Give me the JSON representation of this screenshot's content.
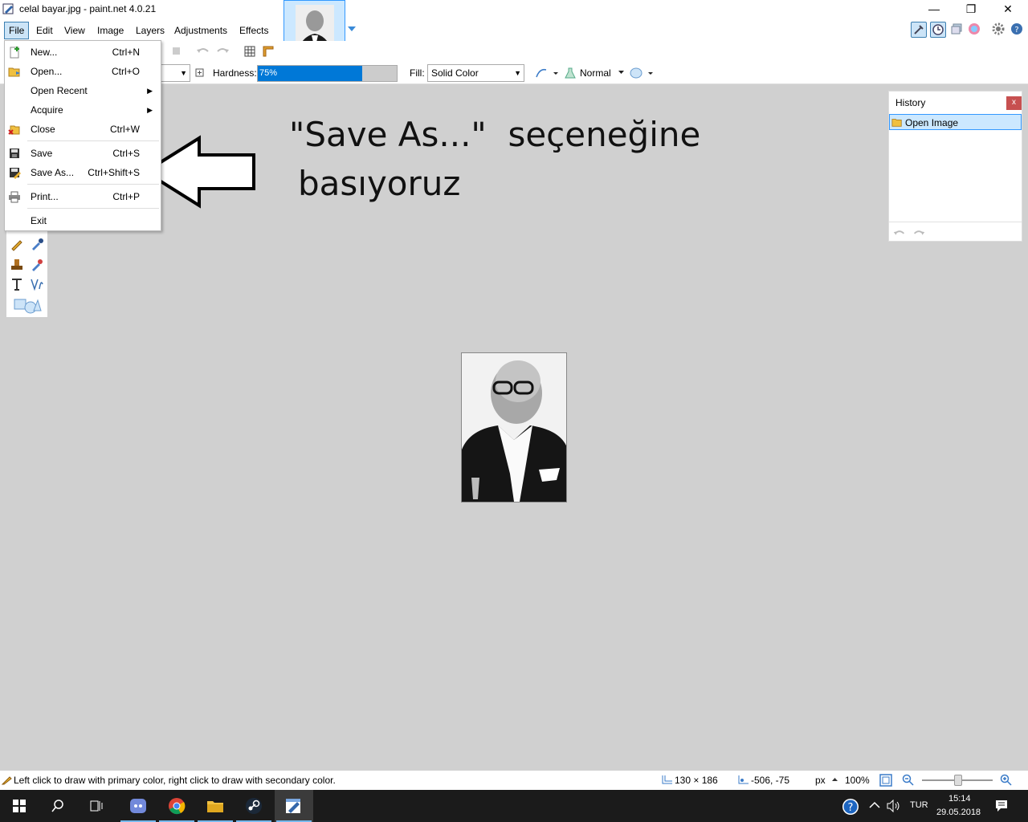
{
  "window": {
    "title": "celal bayar.jpg - paint.net 4.0.21",
    "minimize_glyph": "—",
    "maximize_glyph": "❐",
    "close_glyph": "✕"
  },
  "menubar": {
    "items": [
      "File",
      "Edit",
      "View",
      "Image",
      "Layers",
      "Adjustments",
      "Effects"
    ]
  },
  "toolbar": {
    "hardness_label": "Hardness:",
    "hardness_value": "75%",
    "hardness_fraction": 0.75,
    "fill_label": "Fill:",
    "fill_value": "Solid Color",
    "blend_mode": "Normal"
  },
  "file_menu": {
    "items": [
      {
        "label": "New...",
        "shortcut": "Ctrl+N",
        "icon": "new-image-icon"
      },
      {
        "label": "Open...",
        "shortcut": "Ctrl+O",
        "icon": "open-folder-icon"
      },
      {
        "label": "Open Recent",
        "shortcut": "",
        "icon": "",
        "submenu": true
      },
      {
        "label": "Acquire",
        "shortcut": "",
        "icon": "",
        "submenu": true
      },
      {
        "label": "Close",
        "shortcut": "Ctrl+W",
        "icon": "close-file-icon"
      },
      {
        "label": "Save",
        "shortcut": "Ctrl+S",
        "icon": "save-disk-icon"
      },
      {
        "label": "Save As...",
        "shortcut": "Ctrl+Shift+S",
        "icon": "save-as-icon"
      },
      {
        "label": "Print...",
        "shortcut": "Ctrl+P",
        "icon": "printer-icon"
      },
      {
        "label": "Exit",
        "shortcut": "",
        "icon": ""
      }
    ]
  },
  "annotation": {
    "line1": "\"Save As...\"  seçeneğine",
    "line2": "basıyoruz"
  },
  "history": {
    "title": "History",
    "close": "x",
    "items": [
      "Open Image"
    ]
  },
  "statusbar": {
    "hint": "Left click to draw with primary color, right click to draw with secondary color.",
    "image_size": "130 × 186",
    "cursor_position": "-506, -75",
    "unit": "px",
    "zoom": "100%"
  },
  "taskbar": {
    "language": "TUR",
    "time": "15:14",
    "date": "29.05.2018"
  },
  "colors": {
    "accent": "#0078d7",
    "menu_highlight": "#cce4f7",
    "canvas_bg": "#d0d0d0",
    "taskbar_bg": "#1b1b1b"
  }
}
